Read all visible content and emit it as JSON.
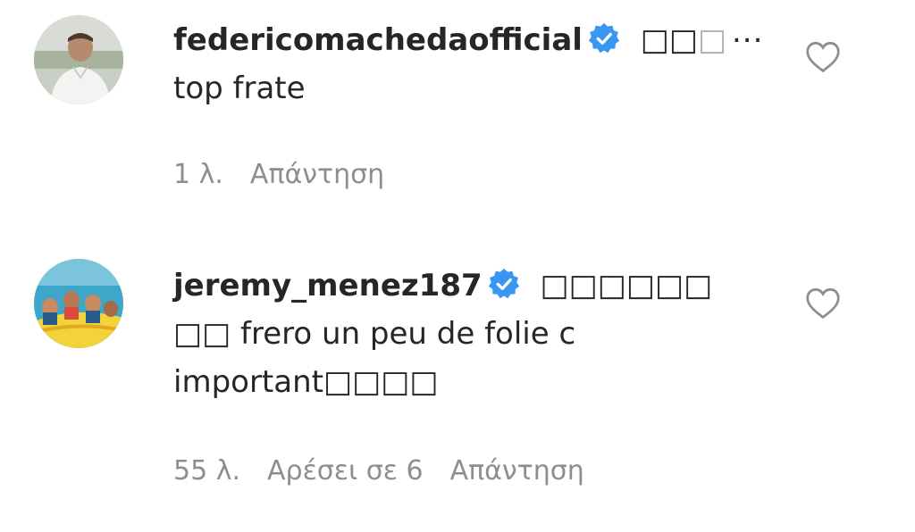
{
  "comments": [
    {
      "username": "federicomachedaofficial",
      "emoji_start": "□□",
      "emoji_faded": "□",
      "more": "...",
      "text_line2": "top frate",
      "time": "1 λ.",
      "reply": "Απάντηση"
    },
    {
      "username": "jeremy_menez187",
      "text_line1_end": "□□□□□□",
      "text_line2": "□□ frero un peu de folie c",
      "text_line3": "important□□□□",
      "time": "55 λ.",
      "likes": "Αρέσει σε 6",
      "reply": "Απάντηση"
    }
  ],
  "colors": {
    "text": "#262626",
    "meta": "#8e8e8e",
    "verified": "#3897f0",
    "heart_stroke": "#8e8e8e"
  },
  "icons": {
    "verified": "verified-badge-icon",
    "like": "heart-icon"
  }
}
